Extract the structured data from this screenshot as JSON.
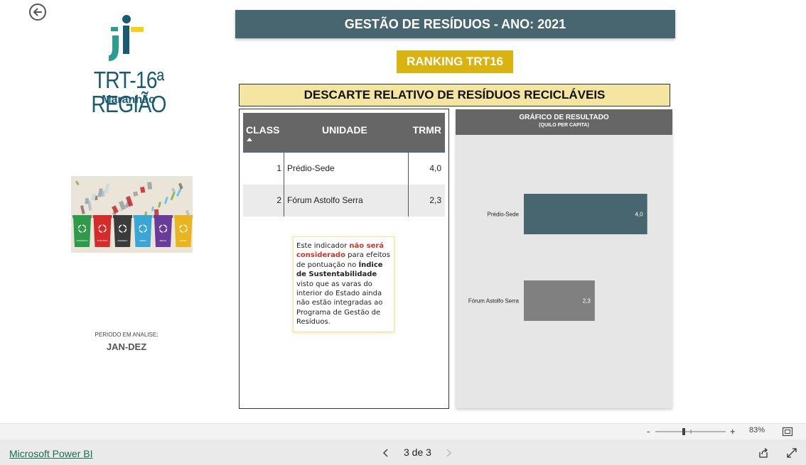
{
  "header": {
    "title": "GESTÃO DE RESÍDUOS - ANO: 2021",
    "ranking_label": "RANKING TRT16",
    "section_title": "DESCARTE RELATIVO DE RESÍDUOS RECICLÁVEIS"
  },
  "logo": {
    "name": "TRT-16ª REGIÃO",
    "sub": "Maranhão",
    "colors": {
      "navy": "#1b5a73",
      "teal": "#2a9d8f",
      "yellow": "#f2d21b"
    }
  },
  "bins_image": {
    "labels": [
      "ORGÂNICO",
      "PLÁSTICO",
      "MADEIRA",
      "VIDRO",
      "METAL",
      "PAPEL"
    ],
    "colors": [
      "#2e9a4a",
      "#d52b2b",
      "#3b3b3b",
      "#3aa6d6",
      "#6a3b9a",
      "#e9b51e"
    ]
  },
  "period": {
    "label": "PERIODO EM ANALISE:",
    "value": "JAN-DEZ"
  },
  "table": {
    "headers": {
      "class": "CLASS",
      "unit": "UNIDADE",
      "trmr": "TRMR"
    },
    "rows": [
      {
        "class": "1",
        "unit": "Prédio-Sede",
        "trmr": "4,0"
      },
      {
        "class": "2",
        "unit": "Fórum Astolfo Serra",
        "trmr": "2,3"
      }
    ]
  },
  "note": {
    "p1": "Este indicador ",
    "p2": "não será considerado",
    "p3": " para efeitos de pontuação no ",
    "p4": "Índice de Sustentabilidade",
    "p5": " visto que as varas do interior do Estado ainda não estão integradas ao Programa de Gestão de Resíduos."
  },
  "chart_data": {
    "type": "bar",
    "orientation": "horizontal",
    "title": "GRÁFICO DE RESULTADO",
    "subtitle": "(QUILO PER CAPITA)",
    "categories": [
      "Prédio-Sede",
      "Fórum Astolfo Serra"
    ],
    "values": [
      4.0,
      2.3
    ],
    "value_labels": [
      "4,0",
      "2,3"
    ],
    "colors": [
      "#476670",
      "#808080"
    ],
    "xlim": [
      0,
      4.7
    ],
    "grid": false
  },
  "footer": {
    "zoom": "83%",
    "page": "3 de 3",
    "brand_link": "Microsoft Power BI"
  }
}
